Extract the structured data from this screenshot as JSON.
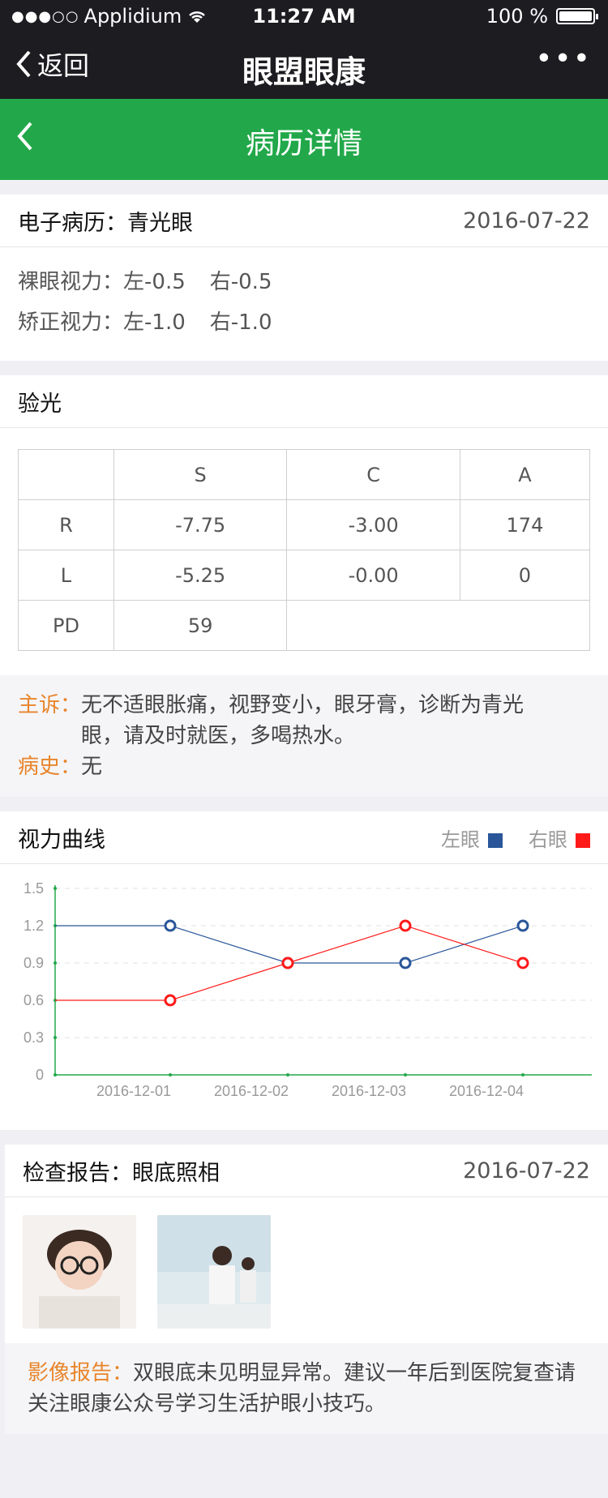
{
  "status": {
    "carrier": "Applidium",
    "time": "11:27 AM",
    "battery": "100 %"
  },
  "nav": {
    "back_label": "返回",
    "title": "眼盟眼康",
    "more": "•••"
  },
  "page": {
    "title": "病历详情"
  },
  "record": {
    "label": "电子病历：青光眼",
    "date": "2016-07-22",
    "naked": {
      "label": "裸眼视力：",
      "left": "左-0.5",
      "right": "右-0.5"
    },
    "corrected": {
      "label": "矫正视力：",
      "left": "左-1.0",
      "right": "右-1.0"
    }
  },
  "refraction": {
    "title": "验光",
    "headers": [
      "",
      "S",
      "C",
      "A"
    ],
    "rows": [
      [
        "R",
        "-7.75",
        "-3.00",
        "174"
      ],
      [
        "L",
        "-5.25",
        "-0.00",
        "0"
      ]
    ],
    "pd": {
      "label": "PD",
      "value": "59"
    }
  },
  "complaint": {
    "label": "主诉：",
    "text1": "无不适眼胀痛，视野变小，眼牙膏，诊断为青光",
    "text2": "眼，请及时就医，多喝热水。",
    "history_label": "病史：",
    "history_text": "无"
  },
  "curve": {
    "title": "视力曲线",
    "legend_left": "左眼",
    "legend_right": "右眼",
    "left_color": "#2a5699",
    "right_color": "#ff1a1a"
  },
  "chart_data": {
    "type": "line",
    "categories": [
      "2016-12-01",
      "2016-12-02",
      "2016-12-03",
      "2016-12-04"
    ],
    "series": [
      {
        "name": "左眼",
        "values": [
          1.2,
          0.9,
          0.9,
          1.2
        ],
        "color": "#2a5699"
      },
      {
        "name": "右眼",
        "values": [
          0.6,
          0.9,
          1.2,
          0.9
        ],
        "color": "#ff1a1a"
      }
    ],
    "yticks": [
      "0",
      "0.3",
      "0.6",
      "0.9",
      "1.2",
      "1.5"
    ],
    "ylim": [
      0,
      1.5
    ],
    "grid": true
  },
  "exam": {
    "label": "检查报告：眼底照相",
    "date": "2016-07-22",
    "images": [
      "child-with-glasses-photo",
      "clinic-staff-photo"
    ],
    "report_label": "影像报告：",
    "report_text": "双眼底未见明显异常。建议一年后到医院复查请关注眼康公众号学习生活护眼小技巧。"
  }
}
